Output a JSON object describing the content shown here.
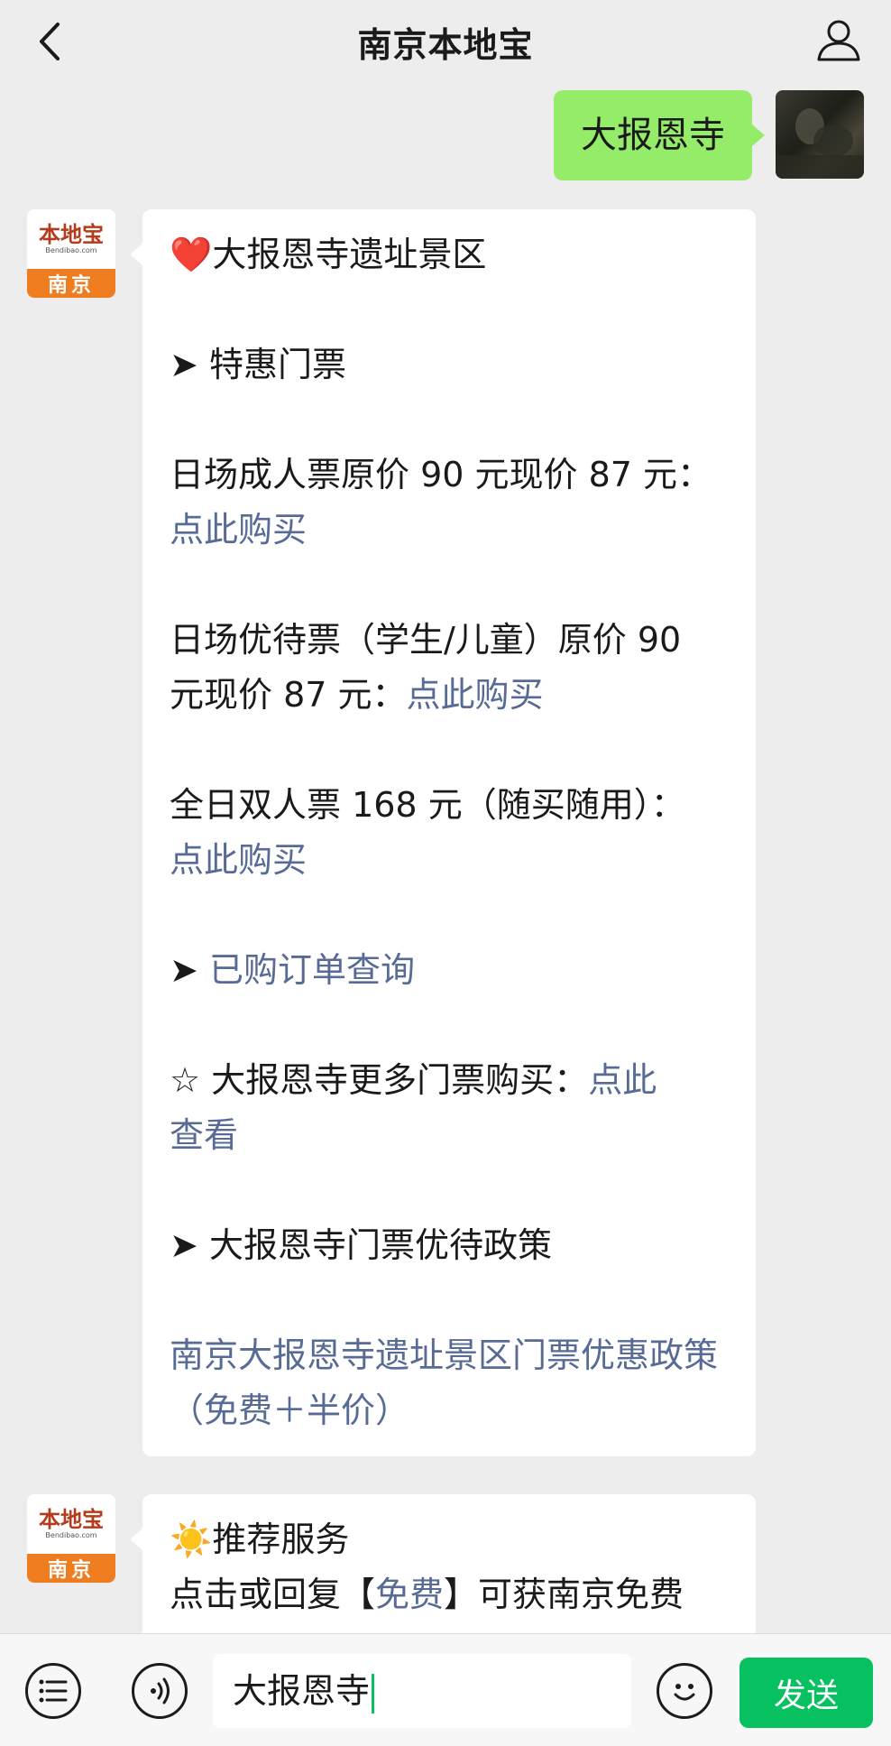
{
  "header": {
    "title": "南京本地宝",
    "back_icon": "chevron-left-icon",
    "profile_icon": "user-icon"
  },
  "outgoing": {
    "text": "大报恩寺"
  },
  "bot": {
    "logo_text": "本地宝",
    "logo_sub": "Bendibao.com",
    "city": "南京"
  },
  "message1": {
    "heart": "❤️",
    "title": "大报恩寺遗址景区",
    "arrow": "➤",
    "special_tickets": "特惠门票",
    "adult_ticket": "日场成人票原价 90 元现价 87 元：",
    "buy_link": "点此购买",
    "discount_ticket_a": "日场优待票（学生/儿童）原价 90",
    "discount_ticket_b": "元现价 87 元：",
    "double_ticket": "全日双人票 168 元（随买随用）：",
    "order_query": "已购订单查询",
    "star": "☆",
    "more_tickets": "大报恩寺更多门票购买：",
    "more_link_a": "点此",
    "more_link_b": "查看",
    "policy_heading": "大报恩寺门票优待政策",
    "policy_link": "南京大报恩寺遗址景区门票优惠政策（免费＋半价）"
  },
  "message2": {
    "sun": "☀️",
    "title": "推荐服务",
    "text_a": "点击或回复【",
    "free_link": "免费",
    "text_b": "】可获南京免费"
  },
  "input": {
    "voice_icon": "list-icon",
    "mic_icon": "voice-icon",
    "value": "大报恩寺",
    "emoji_icon": "smile-icon",
    "send_label": "发送"
  }
}
